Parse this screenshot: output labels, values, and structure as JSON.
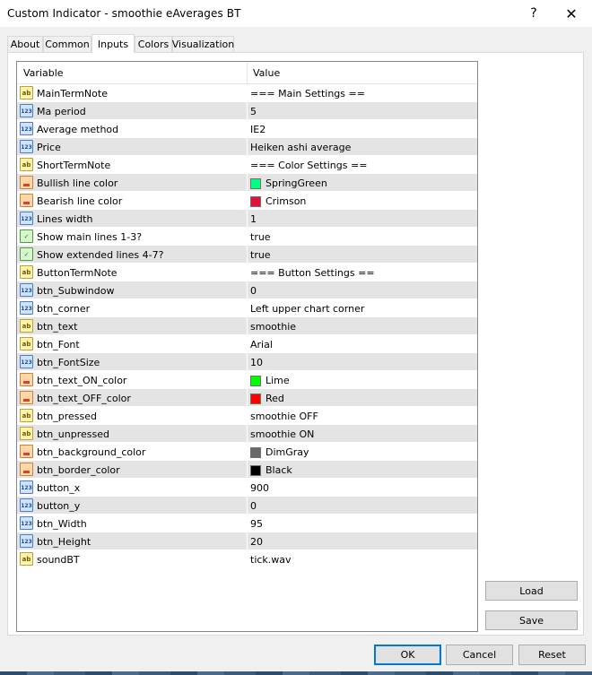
{
  "window": {
    "title": "Custom Indicator - smoothie eAverages BT",
    "help_glyph": "?",
    "close_glyph": "✕"
  },
  "tabs": [
    {
      "label": "About"
    },
    {
      "label": "Common"
    },
    {
      "label": "Inputs",
      "active": true
    },
    {
      "label": "Colors"
    },
    {
      "label": "Visualization"
    }
  ],
  "grid": {
    "header_variable": "Variable",
    "header_value": "Value",
    "rows": [
      {
        "type": "text",
        "icon_label": "ab",
        "variable": "MainTermNote",
        "value": "=== Main Settings =="
      },
      {
        "type": "num",
        "icon_label": "123",
        "variable": "Ma period",
        "value": "5"
      },
      {
        "type": "num",
        "icon_label": "123",
        "variable": "Average method",
        "value": "IE2"
      },
      {
        "type": "num",
        "icon_label": "123",
        "variable": "Price",
        "value": "Heiken ashi average"
      },
      {
        "type": "text",
        "icon_label": "ab",
        "variable": "ShortTermNote",
        "value": "=== Color Settings =="
      },
      {
        "type": "color",
        "icon_label": "",
        "variable": "Bullish  line  color",
        "value": "SpringGreen",
        "swatch": "#00ff7f"
      },
      {
        "type": "color",
        "icon_label": "",
        "variable": "Bearish  line  color",
        "value": "Crimson",
        "swatch": "#dc143c"
      },
      {
        "type": "num",
        "icon_label": "123",
        "variable": "Lines width",
        "value": "1"
      },
      {
        "type": "bool",
        "icon_label": "✓",
        "variable": "Show main lines 1-3?",
        "value": "true"
      },
      {
        "type": "bool",
        "icon_label": "✓",
        "variable": "Show extended lines 4-7?",
        "value": "true"
      },
      {
        "type": "text",
        "icon_label": "ab",
        "variable": "ButtonTermNote",
        "value": "=== Button Settings =="
      },
      {
        "type": "num",
        "icon_label": "123",
        "variable": "btn_Subwindow",
        "value": "0"
      },
      {
        "type": "num",
        "icon_label": "123",
        "variable": "btn_corner",
        "value": "Left upper chart corner"
      },
      {
        "type": "text",
        "icon_label": "ab",
        "variable": "btn_text",
        "value": "smoothie"
      },
      {
        "type": "text",
        "icon_label": "ab",
        "variable": "btn_Font",
        "value": "Arial"
      },
      {
        "type": "num",
        "icon_label": "123",
        "variable": "btn_FontSize",
        "value": "10"
      },
      {
        "type": "color",
        "icon_label": "",
        "variable": "btn_text_ON_color",
        "value": "Lime",
        "swatch": "#00ff00"
      },
      {
        "type": "color",
        "icon_label": "",
        "variable": "btn_text_OFF_color",
        "value": "Red",
        "swatch": "#ff0000"
      },
      {
        "type": "text",
        "icon_label": "ab",
        "variable": "btn_pressed",
        "value": "smoothie OFF"
      },
      {
        "type": "text",
        "icon_label": "ab",
        "variable": "btn_unpressed",
        "value": "smoothie ON"
      },
      {
        "type": "color",
        "icon_label": "",
        "variable": "btn_background_color",
        "value": "DimGray",
        "swatch": "#696969"
      },
      {
        "type": "color",
        "icon_label": "",
        "variable": "btn_border_color",
        "value": "Black",
        "swatch": "#000000"
      },
      {
        "type": "num",
        "icon_label": "123",
        "variable": "button_x",
        "value": "900"
      },
      {
        "type": "num",
        "icon_label": "123",
        "variable": "button_y",
        "value": "0"
      },
      {
        "type": "num",
        "icon_label": "123",
        "variable": "btn_Width",
        "value": "95"
      },
      {
        "type": "num",
        "icon_label": "123",
        "variable": "btn_Height",
        "value": "20"
      },
      {
        "type": "text",
        "icon_label": "ab",
        "variable": "soundBT",
        "value": "tick.wav"
      }
    ]
  },
  "side_buttons": {
    "load": "Load",
    "save": "Save"
  },
  "footer": {
    "ok": "OK",
    "cancel": "Cancel",
    "reset": "Reset"
  }
}
